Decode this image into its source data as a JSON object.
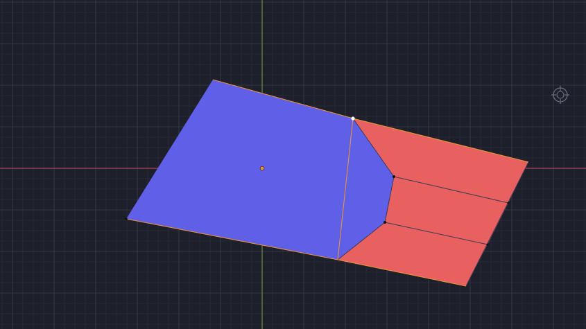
{
  "viewport": {
    "background_color": "#1d1f2b",
    "grid": {
      "minor_color": "#272a38",
      "major_color": "#343846"
    },
    "axes": {
      "x_axis_color": "#b0465a",
      "y_axis_color": "#6a8c3a"
    }
  },
  "mesh": {
    "selected_face_color": "#5f5fe8",
    "unselected_face_color": "#e86060",
    "edge_color": "#3b3b55",
    "selected_edge_color": "#e8933a",
    "vertex_color": "#111111",
    "active_vertex_color": "#ffffff",
    "origin_color": "#f0953a"
  },
  "overlay": {
    "navigation_icon": "crosshair-target-icon",
    "icon_color": "#6c6f80"
  }
}
